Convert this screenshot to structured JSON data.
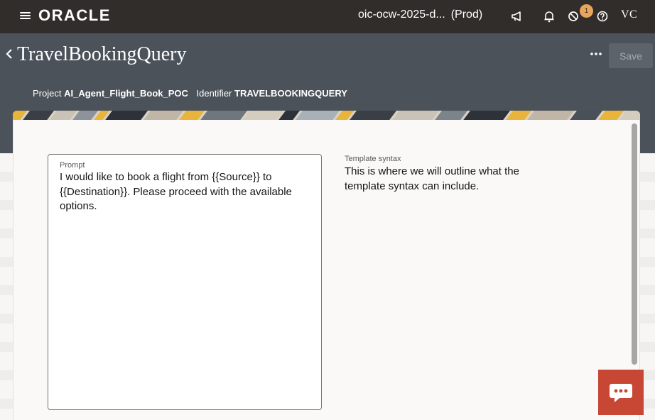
{
  "topbar": {
    "brand": "ORACLE",
    "instance": "oic-ocw-2025-d...",
    "environment": "(Prod)",
    "notification_count": "1",
    "user_initials": "VC",
    "icons": [
      "menu-icon",
      "megaphone-icon",
      "bell-icon",
      "blocked-icon",
      "help-icon"
    ]
  },
  "header": {
    "title": "TravelBookingQuery",
    "save_label": "Save",
    "project_label": "Project",
    "project_value": "AI_Agent_Flight_Book_POC",
    "identifier_label": "Identifier",
    "identifier_value": "TRAVELBOOKINGQUERY"
  },
  "prompt": {
    "label": "Prompt",
    "value": "I would like to book a flight from {{Source}} to {{Destination}}. Please proceed with the available options."
  },
  "template_syntax": {
    "label": "Template syntax",
    "text": "This is where we will outline what the template syntax can include."
  },
  "colors": {
    "topbar": "#312d2a",
    "header": "#4c525a",
    "accent": "#c74634",
    "badge": "#e8a65b"
  }
}
